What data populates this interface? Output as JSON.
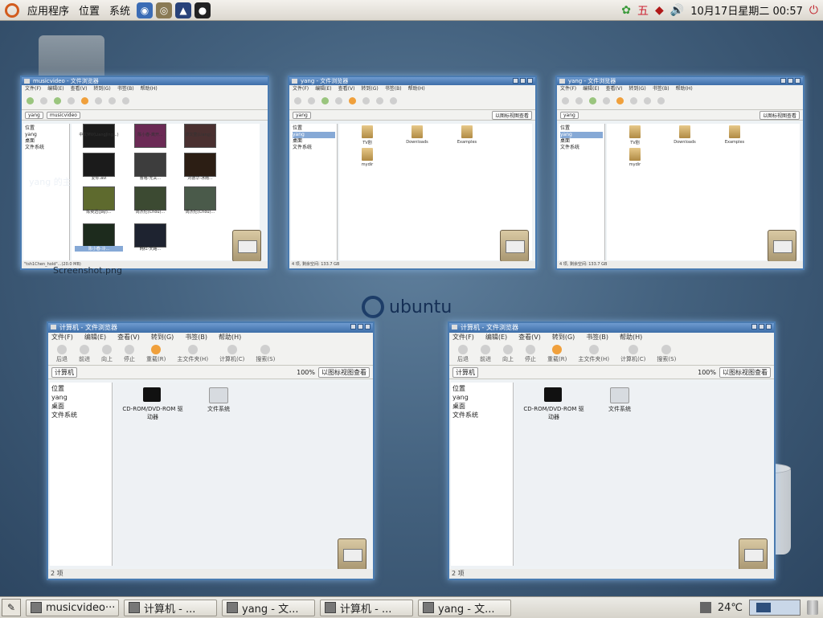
{
  "top_panel": {
    "menus": [
      "应用程序",
      "位置",
      "系统"
    ],
    "launchers": [
      "firefox-icon",
      "gimp-icon",
      "pidgin-icon",
      "qq-icon"
    ],
    "tray": {
      "extra1": "五",
      "clock": "10月17日星期二 00:57"
    }
  },
  "desktop": {
    "home_label": "yang 的主",
    "screenshot_label": "Screenshot.png",
    "brand": "ubuntu"
  },
  "windows": {
    "musicvideo": {
      "title": "musicvideo - 文件浏览器",
      "status": "\"tsh1Chen_hold\"...(20.0 MB)",
      "items": [
        "中文MV(LiangJing...)",
        "陈小春-离开...",
        "卓文萱(Liang)...",
        "爱你.avi",
        "曹格-无关...",
        "刘德华-冰雨...",
        "陈奕迅(Jay)...",
        "周杰伦(Chou)...",
        "周杰伦(Chou)...",
        "陈小春-冷...",
        "韩红-天路..."
      ]
    },
    "yang1": {
      "title": "yang - 文件浏览器",
      "crumb": "yang",
      "side": [
        "位置",
        "yang",
        "桌面",
        "文件系统"
      ],
      "folders": [
        "TV剧",
        "Downloads",
        "Examples",
        "mydir"
      ],
      "status": "4 项, 剩余空间: 133.7 GB",
      "view": "以图标视图查看"
    },
    "yang2": {
      "title": "yang - 文件浏览器",
      "crumb": "yang",
      "side": [
        "位置",
        "yang",
        "桌面",
        "文件系统"
      ],
      "folders": [
        "TV剧",
        "Downloads",
        "Examples",
        "mydir"
      ],
      "status": "4 项, 剩余空间: 133.7 GB",
      "view": "以图标视图查看"
    },
    "computer1": {
      "title": "计算机 - 文件浏览器",
      "menus": [
        "文件(F)",
        "编辑(E)",
        "查看(V)",
        "转到(G)",
        "书签(B)",
        "帮助(H)"
      ],
      "toolbar": [
        "后退",
        "前进",
        "向上",
        "停止",
        "重载(R)",
        "主文件夹(H)",
        "计算机(C)",
        "搜索(S)"
      ],
      "crumb": "计算机",
      "zoom": "100%",
      "view": "以图标视图查看",
      "side": [
        "位置",
        "yang",
        "桌面",
        "文件系统"
      ],
      "drives": [
        "CD-ROM/DVD-ROM 驱动器",
        "文件系统"
      ],
      "status": "2 项"
    },
    "computer2": {
      "title": "计算机 - 文件浏览器",
      "menus": [
        "文件(F)",
        "编辑(E)",
        "查看(V)",
        "转到(G)",
        "书签(B)",
        "帮助(H)"
      ],
      "toolbar": [
        "后退",
        "前进",
        "向上",
        "停止",
        "重载(R)",
        "主文件夹(H)",
        "计算机(C)",
        "搜索(S)"
      ],
      "crumb": "计算机",
      "zoom": "100%",
      "view": "以图标视图查看",
      "side": [
        "位置",
        "yang",
        "桌面",
        "文件系统"
      ],
      "drives": [
        "CD-ROM/DVD-ROM 驱动器",
        "文件系统"
      ],
      "status": "2 项"
    }
  },
  "taskbar": {
    "tasks": [
      "musicvideo···",
      "计算机 - ...",
      "yang - 文...",
      "计算机 - ...",
      "yang - 文..."
    ],
    "temperature": "24℃"
  },
  "colors": {
    "accent": "#4a7bb0",
    "ubuntu_orange": "#d25b1d",
    "desktop": "#44627f"
  }
}
